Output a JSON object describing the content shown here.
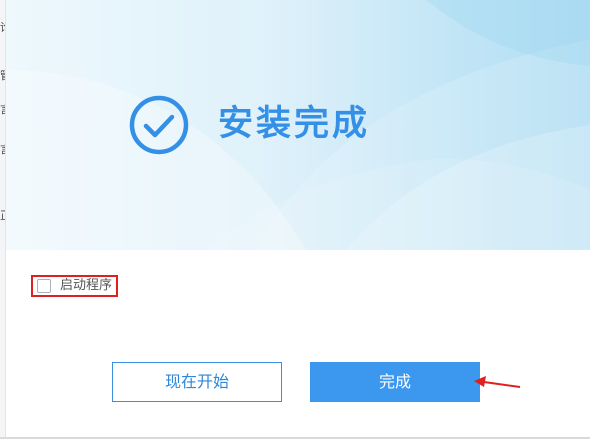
{
  "header": {
    "title": "安装完成",
    "icon": "check-circle-icon",
    "accent_color": "#3390e6"
  },
  "options": {
    "launch_program_label": "启动程序",
    "launch_program_checked": false
  },
  "buttons": {
    "start_now_label": "现在开始",
    "finish_label": "完成",
    "primary_color": "#3c97ee"
  },
  "annotation": {
    "highlight_color": "#e02020",
    "arrow": "left-arrow-icon"
  },
  "background_window": {
    "edge_fragments": [
      "论",
      "管",
      "言",
      "言",
      "正"
    ]
  }
}
